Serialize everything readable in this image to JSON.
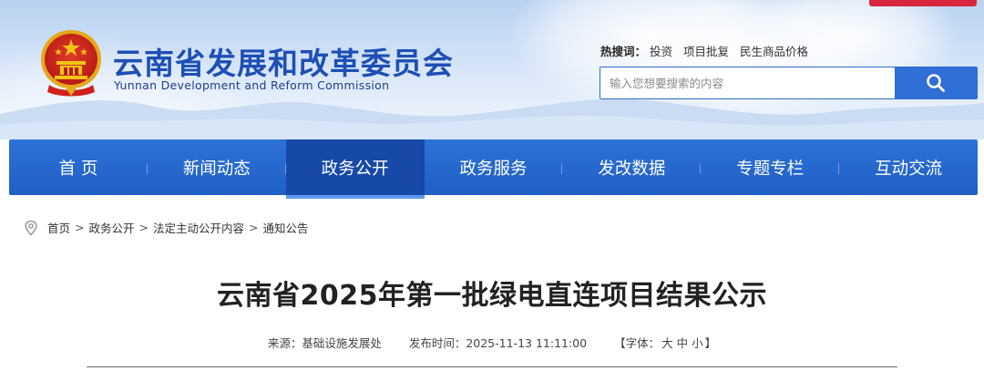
{
  "header": {
    "site_title": "云南省发展和改革委员会",
    "site_subtitle": "Yunnan Development and Reform Commission"
  },
  "hot_search": {
    "label": "热搜词：",
    "terms": [
      "投资",
      "项目批复",
      "民生商品价格"
    ]
  },
  "search": {
    "placeholder": "输入您想要搜索的内容",
    "button_icon": "search-icon"
  },
  "nav": {
    "items": [
      "首 页",
      "新闻动态",
      "政务公开",
      "政务服务",
      "发改数据",
      "专题专栏",
      "互动交流"
    ],
    "active_index": 2
  },
  "breadcrumb": {
    "icon": "location-pin-icon",
    "items": [
      "首页",
      "政务公开",
      "法定主动公开内容",
      "通知公告"
    ],
    "separator": ">"
  },
  "article": {
    "title": "云南省2025年第一批绿电直连项目结果公示",
    "source": "来源：基础设施发展处",
    "publish_time": "发布时间：2025-11-13 11:11:00",
    "font_size_open": "【字体：",
    "font_sizes": [
      "大",
      "中",
      "小"
    ],
    "font_size_close": "】"
  },
  "colors": {
    "brand_blue": "#1d4fb5",
    "nav_blue": "#2d72d6",
    "nav_active": "#1649a8",
    "accent_red": "#d7263d"
  }
}
